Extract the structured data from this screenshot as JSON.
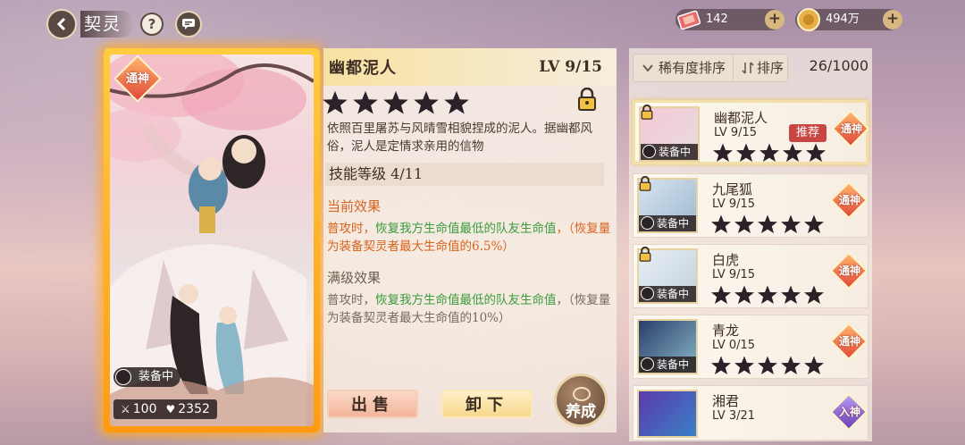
{
  "header": {
    "title": "契灵",
    "help": "?"
  },
  "currencies": [
    {
      "name": "ticket",
      "value": "142"
    },
    {
      "name": "coin",
      "value": "494万"
    }
  ],
  "card": {
    "badge": "通神",
    "equip": "装备中",
    "attack": "100",
    "hp": "2352"
  },
  "detail": {
    "name": "幽都泥人",
    "level": "LV 9/15",
    "stars": 5,
    "description": "依照百里屠苏与风晴雪相貌捏成的泥人。据幽都风俗，泥人是定情求亲用的信物",
    "skill_level": "技能等级 4/11",
    "current_title": "当前效果",
    "current_a": "普攻时，",
    "current_b": "恢复我方生命值最低的队友生命值",
    "current_c": "，（恢复量为装备契灵者最大生命值的6.5%）",
    "max_title": "满级效果",
    "max_a": "普攻时，",
    "max_b": "恢复我方生命值最低的队友生命值",
    "max_c": "，（恢复量为装备契灵者最大生命值的10%）",
    "sell": "出售",
    "unequip": "卸下",
    "raise": "养成"
  },
  "list": {
    "sort_rarity": "稀有度排序",
    "sort_order": "排序",
    "count": "26/1000",
    "items": [
      {
        "name": "幽都泥人",
        "level": "LV 9/15",
        "badge": "通神",
        "equip": "装备中",
        "tag": "推荐"
      },
      {
        "name": "九尾狐",
        "level": "LV 9/15",
        "badge": "通神",
        "equip": "装备中"
      },
      {
        "name": "白虎",
        "level": "LV 9/15",
        "badge": "通神",
        "equip": "装备中"
      },
      {
        "name": "青龙",
        "level": "LV 0/15",
        "badge": "通神",
        "equip": "装备中"
      },
      {
        "name": "湘君",
        "level": "LV 3/21",
        "badge": "入神"
      }
    ]
  }
}
